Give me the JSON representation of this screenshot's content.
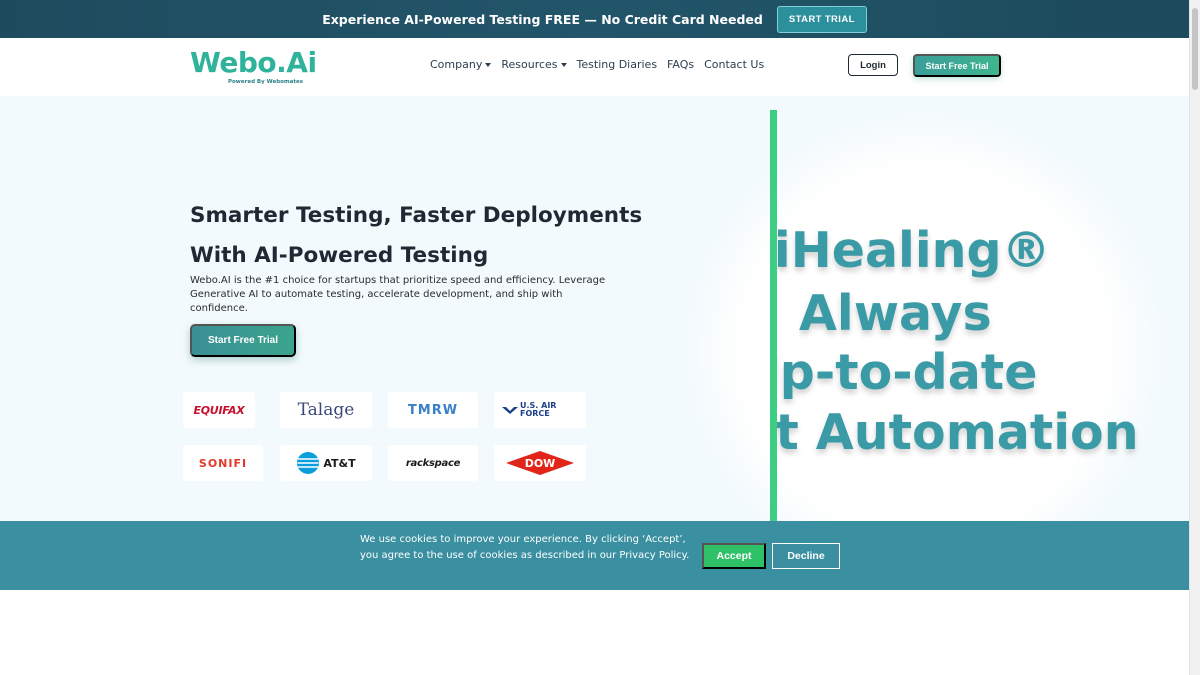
{
  "announcement": {
    "text": "Experience AI-Powered Testing FREE — No Credit Card Needed",
    "button_label": "START TRIAL"
  },
  "header": {
    "logo_main": "Webo.Ai",
    "logo_sub": "Powered By Webomates",
    "nav": [
      {
        "label": "Company",
        "dropdown": true
      },
      {
        "label": "Resources",
        "dropdown": true
      },
      {
        "label": "Testing Diaries",
        "dropdown": false
      },
      {
        "label": "FAQs",
        "dropdown": false
      },
      {
        "label": "Contact Us",
        "dropdown": false
      }
    ],
    "login_label": "Login",
    "trial_label": "Start Free Trial"
  },
  "hero": {
    "title_line1": "Smarter Testing, Faster Deployments",
    "title_line2": "With AI-Powered Testing",
    "description": "Webo.AI is the #1 choice for startups that prioritize speed and efficiency. Leverage Generative AI to automate testing, accelerate development, and ship with confidence.",
    "cta_label": "Start Free Trial",
    "client_logos": [
      "EQUIFAX",
      "Talage",
      "TMRW",
      "U.S. AIR FORCE",
      "SONIFI",
      "AT&T",
      "rackspace",
      "DOW"
    ],
    "slogan_lines": [
      "AiHealing®",
      "Always",
      "Up-to-date",
      "Test Automation"
    ]
  },
  "cookie": {
    "text": "We use cookies to improve your experience. By clicking ‘Accept’, you agree to the use of cookies as described in our Privacy Policy.",
    "accept_label": "Accept",
    "decline_label": "Decline"
  },
  "colors": {
    "accent": "#3a9aa5",
    "green": "#3dcd83",
    "announcement_bg": "#1f4b5e",
    "cookie_bg": "#3a8fa0"
  }
}
